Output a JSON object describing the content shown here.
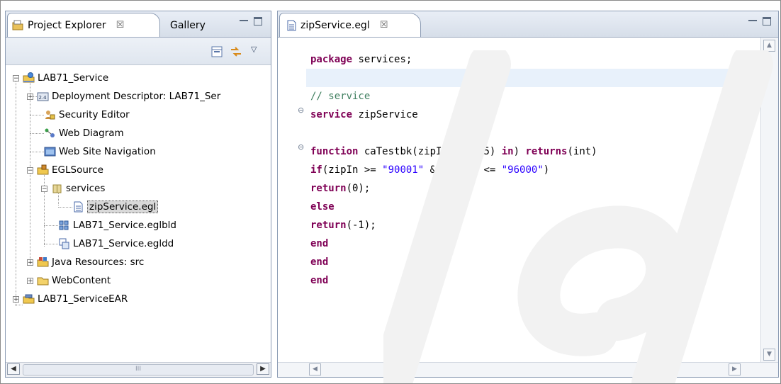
{
  "project_explorer": {
    "tab_label": "Project Explorer",
    "tab_close": "☒",
    "second_tab_label": "Gallery",
    "tree": [
      {
        "label": "LAB71_Service",
        "toggle": "−",
        "icon": "web-project-icon"
      },
      {
        "label": "Deployment Descriptor: LAB71_Ser",
        "toggle": "+",
        "icon": "deployment-descriptor-icon"
      },
      {
        "label": "Security Editor",
        "toggle": "",
        "icon": "security-editor-icon"
      },
      {
        "label": "Web Diagram",
        "toggle": "",
        "icon": "web-diagram-icon"
      },
      {
        "label": "Web Site Navigation",
        "toggle": "",
        "icon": "web-site-navigation-icon"
      },
      {
        "label": "EGLSource",
        "toggle": "−",
        "icon": "source-folder-icon"
      },
      {
        "label": "services",
        "toggle": "−",
        "icon": "package-icon"
      },
      {
        "label": "zipService.egl",
        "toggle": "",
        "icon": "egl-file-icon"
      },
      {
        "label": "LAB71_Service.eglbld",
        "toggle": "",
        "icon": "build-descriptor-icon"
      },
      {
        "label": "LAB71_Service.egldd",
        "toggle": "",
        "icon": "deployment-file-icon"
      },
      {
        "label": "Java Resources: src",
        "toggle": "+",
        "icon": "java-resources-icon"
      },
      {
        "label": "WebContent",
        "toggle": "+",
        "icon": "folder-icon"
      },
      {
        "label": "LAB71_ServiceEAR",
        "toggle": "+",
        "icon": "ear-project-icon"
      }
    ],
    "scroll_thumb_grip": "III"
  },
  "editor": {
    "tab_label": "zipService.egl",
    "tab_close": "☒",
    "lines": {
      "l1_kw": "package",
      "l1_rest": " services;",
      "l3": "// service",
      "l4_kw": "service",
      "l4_rest": " zipService",
      "l6_kw1": "function",
      "l6_a": " caTestbk(zipIn ",
      "l6_kw2": "char",
      "l6_b": "(5) ",
      "l6_kw3": "in",
      "l6_c": ") ",
      "l6_kw4": "returns",
      "l6_d": "(int)",
      "l7_kw": "if",
      "l7_a": "(zipIn >= ",
      "l7_s1": "\"90001\"",
      "l7_b": " && zipIn <= ",
      "l7_s2": "\"96000\"",
      "l7_c": ")",
      "l8_kw": "return",
      "l8_rest": "(0);",
      "l9_kw": "else",
      "l10_kw": "return",
      "l10_rest": "(-1);",
      "l11_kw": "end",
      "l12_kw": "end",
      "l13_kw": "end"
    },
    "fold_marker": "⊖"
  },
  "colors": {
    "keyword": "#7f0055",
    "string": "#2a00ff",
    "comment": "#3f7f5f",
    "current_line": "#e8f1fb"
  }
}
